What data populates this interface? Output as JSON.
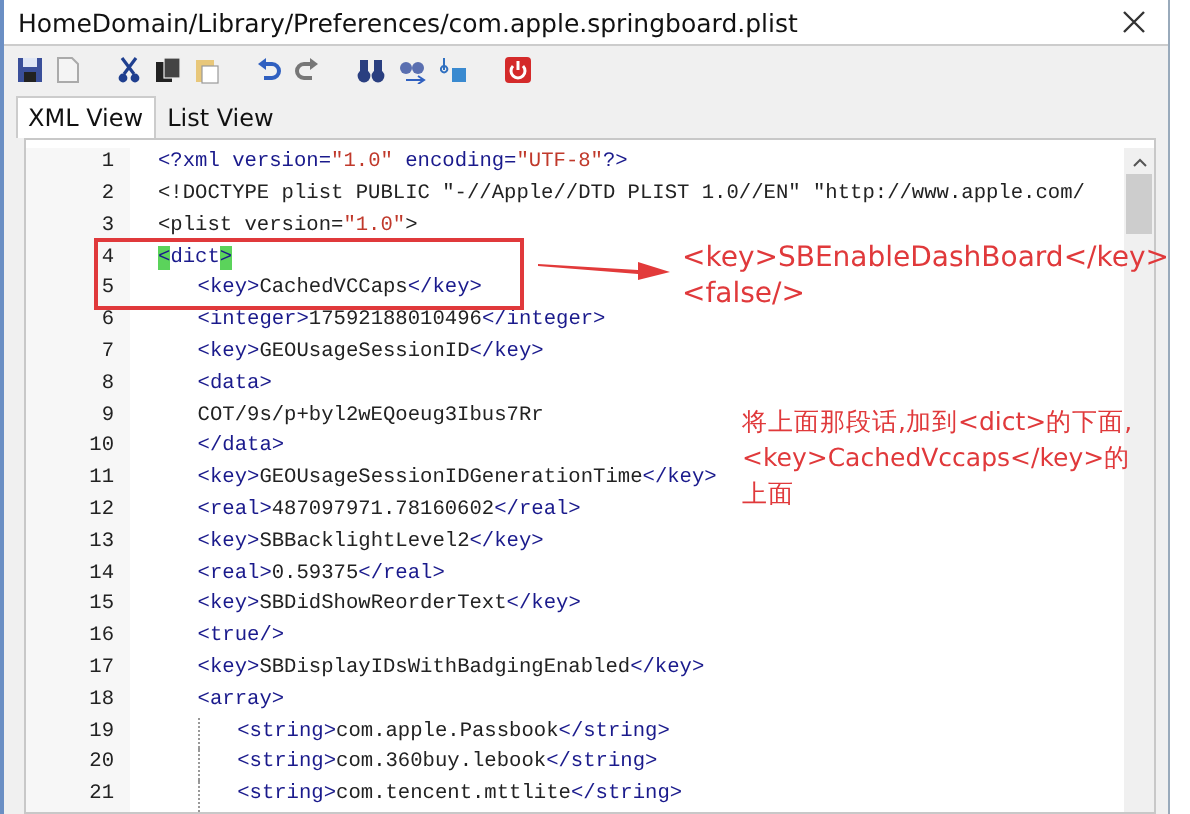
{
  "window": {
    "title": "HomeDomain/Library/Preferences/com.apple.springboard.plist"
  },
  "tabs": [
    {
      "label": "XML View",
      "selected": true
    },
    {
      "label": "List View",
      "selected": false
    }
  ],
  "editor": {
    "lines": [
      {
        "number": "1",
        "tokens": [
          {
            "kind": "tag",
            "t": "<?"
          },
          {
            "kind": "name",
            "t": "xml"
          },
          {
            "kind": "tag",
            "t": " version="
          },
          {
            "kind": "string",
            "t": "\"1.0\""
          },
          {
            "kind": "tag",
            "t": " encoding="
          },
          {
            "kind": "string",
            "t": "\"UTF-8\""
          },
          {
            "kind": "tag",
            "t": "?>"
          }
        ]
      },
      {
        "number": "2",
        "tokens": [
          {
            "kind": "text",
            "t": "<!DOCTYPE plist PUBLIC \"-//Apple//DTD PLIST 1.0//EN\" \"http://www.apple.com/"
          }
        ]
      },
      {
        "number": "3",
        "tokens": [
          {
            "kind": "text",
            "t": "<plist version="
          },
          {
            "kind": "string",
            "t": "\"1.0\""
          },
          {
            "kind": "text",
            "t": ">"
          }
        ]
      },
      {
        "number": "4",
        "tokens": [
          {
            "kind": "match",
            "t": "<"
          },
          {
            "kind": "name",
            "t": "dict"
          },
          {
            "kind": "match",
            "t": ">"
          }
        ],
        "children": [
          {
            "number": "5",
            "tokens": [
              {
                "kind": "tag",
                "t": "<key>"
              },
              {
                "kind": "text",
                "t": "CachedVCCaps"
              },
              {
                "kind": "tag",
                "t": "</key>"
              }
            ]
          },
          {
            "number": "6",
            "tokens": [
              {
                "kind": "tag",
                "t": "<integer>"
              },
              {
                "kind": "text",
                "t": "17592188010496"
              },
              {
                "kind": "tag",
                "t": "</integer>"
              }
            ]
          },
          {
            "number": "7",
            "tokens": [
              {
                "kind": "tag",
                "t": "<key>"
              },
              {
                "kind": "text",
                "t": "GEOUsageSessionID"
              },
              {
                "kind": "tag",
                "t": "</key>"
              }
            ]
          },
          {
            "number": "8",
            "tokens": [
              {
                "kind": "tag",
                "t": "<data>"
              }
            ]
          },
          {
            "number": "9",
            "tokens": [
              {
                "kind": "text",
                "t": "COT/9s/p+byl2wEQoeug3Ibus7Rr"
              }
            ]
          },
          {
            "number": "10",
            "tokens": [
              {
                "kind": "tag",
                "t": "</data>"
              }
            ]
          },
          {
            "number": "11",
            "tokens": [
              {
                "kind": "tag",
                "t": "<key>"
              },
              {
                "kind": "text",
                "t": "GEOUsageSessionIDGenerationTime"
              },
              {
                "kind": "tag",
                "t": "</key>"
              }
            ]
          },
          {
            "number": "12",
            "tokens": [
              {
                "kind": "tag",
                "t": "<real>"
              },
              {
                "kind": "text",
                "t": "487097971.78160602"
              },
              {
                "kind": "tag",
                "t": "</real>"
              }
            ]
          },
          {
            "number": "13",
            "tokens": [
              {
                "kind": "tag",
                "t": "<key>"
              },
              {
                "kind": "text",
                "t": "SBBacklightLevel2"
              },
              {
                "kind": "tag",
                "t": "</key>"
              }
            ]
          },
          {
            "number": "14",
            "tokens": [
              {
                "kind": "tag",
                "t": "<real>"
              },
              {
                "kind": "text",
                "t": "0.59375"
              },
              {
                "kind": "tag",
                "t": "</real>"
              }
            ]
          },
          {
            "number": "15",
            "tokens": [
              {
                "kind": "tag",
                "t": "<key>"
              },
              {
                "kind": "text",
                "t": "SBDidShowReorderText"
              },
              {
                "kind": "tag",
                "t": "</key>"
              }
            ]
          },
          {
            "number": "16",
            "tokens": [
              {
                "kind": "tag",
                "t": "<true/>"
              }
            ]
          },
          {
            "number": "17",
            "tokens": [
              {
                "kind": "tag",
                "t": "<key>"
              },
              {
                "kind": "text",
                "t": "SBDisplayIDsWithBadgingEnabled"
              },
              {
                "kind": "tag",
                "t": "</key>"
              }
            ]
          },
          {
            "number": "18",
            "tokens": [
              {
                "kind": "tag",
                "t": "<array>"
              }
            ],
            "children": [
              {
                "number": "19",
                "tokens": [
                  {
                    "kind": "tag",
                    "t": "<string>"
                  },
                  {
                    "kind": "text",
                    "t": "com.apple.Passbook"
                  },
                  {
                    "kind": "tag",
                    "t": "</string>"
                  }
                ]
              },
              {
                "number": "20",
                "tokens": [
                  {
                    "kind": "tag",
                    "t": "<string>"
                  },
                  {
                    "kind": "text",
                    "t": "com.360buy.lebook"
                  },
                  {
                    "kind": "tag",
                    "t": "</string>"
                  }
                ]
              },
              {
                "number": "21",
                "tokens": [
                  {
                    "kind": "tag",
                    "t": "<string>"
                  },
                  {
                    "kind": "text",
                    "t": "com.tencent.mttlite"
                  },
                  {
                    "kind": "tag",
                    "t": "</string>"
                  }
                ]
              }
            ]
          }
        ]
      }
    ]
  },
  "annotations": {
    "insert_lines": [
      "<key>SBEnableDashBoard</key>",
      "<false/>"
    ],
    "instruction": "将上面那段话,加到<dict>的下面,<key>CachedVccaps</key>的上面"
  }
}
